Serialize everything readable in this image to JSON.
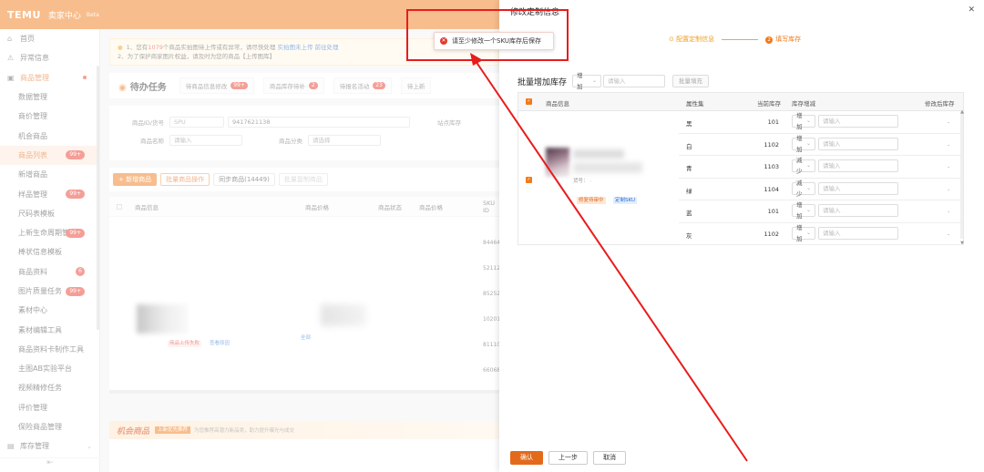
{
  "header": {
    "logo": "TEMU",
    "subtitle": "卖家中心",
    "beta": "Beta"
  },
  "sidebar": {
    "items": [
      {
        "label": "首页",
        "icon": "home-icon",
        "level": "top"
      },
      {
        "label": "异常信息",
        "icon": "warning-icon",
        "level": "top"
      },
      {
        "label": "商品管理",
        "icon": "goods-icon",
        "level": "group"
      },
      {
        "label": "数据管理",
        "level": "sub"
      },
      {
        "label": "商价管理",
        "level": "sub"
      },
      {
        "label": "机会商品",
        "level": "sub"
      },
      {
        "label": "商品列表",
        "level": "sub",
        "badge": "99+",
        "active": true
      },
      {
        "label": "新增商品",
        "level": "sub"
      },
      {
        "label": "样品管理",
        "level": "sub",
        "badge": "99+"
      },
      {
        "label": "尺码表模板",
        "level": "sub"
      },
      {
        "label": "上新生命周期管理",
        "level": "sub",
        "badge": "99+"
      },
      {
        "label": "棒状信息模板",
        "level": "sub"
      },
      {
        "label": "商品资料",
        "level": "sub",
        "badge": "6"
      },
      {
        "label": "图片质量任务",
        "level": "sub",
        "badge": "99+"
      },
      {
        "label": "素材中心",
        "level": "sub"
      },
      {
        "label": "素材编辑工具",
        "level": "sub"
      },
      {
        "label": "商品资料卡制作工具",
        "level": "sub"
      },
      {
        "label": "主图AB实验平台",
        "level": "sub"
      },
      {
        "label": "视频精修任务",
        "level": "sub"
      },
      {
        "label": "评价管理",
        "level": "sub"
      },
      {
        "label": "保险商品管理",
        "level": "sub"
      },
      {
        "label": "库存管理",
        "icon": "warehouse-icon",
        "level": "top",
        "chevron": true
      }
    ],
    "collapse_icon": "collapse-icon"
  },
  "notice": {
    "line1_a": "1、您有",
    "line1_hl": "1079",
    "line1_b": "个商品实拍图待上传或有异常，请尽快处理",
    "line1_lk1": "实拍图未上传",
    "line1_lk2": "前往处理",
    "line2": "2、为了保护商家图片权益，请及时为您的商品【上传图库】"
  },
  "tasks": {
    "title": "待办任务",
    "items": [
      {
        "label": "待商品信息修改",
        "badge": "99+"
      },
      {
        "label": "商品库存待补",
        "badge": "2"
      },
      {
        "label": "待报名活动",
        "badge": "23"
      },
      {
        "label": "待上新"
      }
    ]
  },
  "filters": {
    "row1_label": "商品ID/货号",
    "row1_select": "SPU",
    "row1_value": "9417621138",
    "row1_right": "站点库存",
    "row2_label": "商品名称",
    "row2_placeholder": "请输入",
    "row2_label2": "商品分类",
    "row2_placeholder2": "请选择"
  },
  "actions": {
    "add": "+ 新增商品",
    "batch": "批量商品操作",
    "sync": "同步商品(14449)",
    "export": "批量复制商品"
  },
  "table": {
    "headers": [
      "商品信息",
      "商品价格",
      "商品状态",
      "商品价格"
    ],
    "sku_col": "SKU ID",
    "sku_values": [
      "84464...",
      "52112...",
      "85252...",
      "10201...",
      "81110...",
      "66068..."
    ],
    "row_tag1": "商品上传失败",
    "row_tag2": "查看原因",
    "row_link": "全部"
  },
  "opportunity": {
    "title": "机会商品",
    "tag": "上新优先推荐",
    "desc": "为您推荐高潜力新品类，助力提升曝光与成交"
  },
  "drawer": {
    "title": "修改定制信息",
    "close_icon": "close-icon",
    "steps": [
      {
        "label": "配置定制信息",
        "state": "done"
      },
      {
        "label": "填写库存",
        "num": "2",
        "state": "active"
      }
    ],
    "bulk": {
      "label": "批量增加库存",
      "select": "增加",
      "placeholder": "请输入",
      "button": "批量填充"
    },
    "columns": [
      "商品信息",
      "属性集",
      "当前库存",
      "库存增减",
      "修改后库存"
    ],
    "product_meta": "货号：  ·",
    "product_tags": [
      "修复待审中",
      "定制SKU"
    ],
    "rows": [
      {
        "attr": "黑",
        "stock": "101",
        "op": "增加",
        "placeholder": "请输入",
        "after": "-"
      },
      {
        "attr": "白",
        "stock": "1102",
        "op": "增加",
        "placeholder": "请输入",
        "after": "-"
      },
      {
        "attr": "青",
        "stock": "1103",
        "op": "减少",
        "placeholder": "请输入",
        "after": "-"
      },
      {
        "attr": "绿",
        "stock": "1104",
        "op": "减少",
        "placeholder": "请输入",
        "after": "-"
      },
      {
        "attr": "蓝",
        "stock": "101",
        "op": "增加",
        "placeholder": "请输入",
        "after": "-"
      },
      {
        "attr": "灰",
        "stock": "1102",
        "op": "增加",
        "placeholder": "请输入",
        "after": "-"
      }
    ],
    "footer": {
      "confirm": "确认",
      "prev": "上一步",
      "cancel": "取消"
    }
  },
  "toast": {
    "message": "请至少修改一个SKU库存后保存",
    "icon": "error-icon"
  },
  "colors": {
    "brand": "#f07b1a",
    "error": "#e03a2f",
    "annotation": "#e81c1c"
  }
}
